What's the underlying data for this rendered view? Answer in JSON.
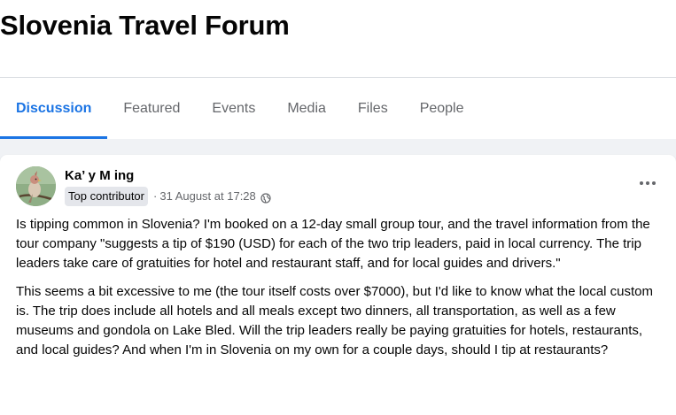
{
  "group": {
    "title": "Slovenia Travel Forum"
  },
  "tabs": [
    {
      "label": "Discussion",
      "active": true
    },
    {
      "label": "Featured",
      "active": false
    },
    {
      "label": "Events",
      "active": false
    },
    {
      "label": "Media",
      "active": false
    },
    {
      "label": "Files",
      "active": false
    },
    {
      "label": "People",
      "active": false
    }
  ],
  "post": {
    "author": "Ka’ y M  ing",
    "badge": "Top contributor",
    "timestamp": "31 August at 17:28",
    "separator": "·",
    "privacy_icon": "globe-icon",
    "more_icon": "more-options-icon",
    "paragraphs": [
      "Is tipping common in Slovenia? I'm booked on a 12-day small group tour, and the travel information from the tour company \"suggests a tip of $190 (USD) for each of the two trip leaders, paid in local currency. The trip leaders take care of gratuities for hotel and restaurant staff, and for local guides and drivers.\"",
      "This seems a bit excessive to me (the tour itself costs over $7000), but I'd like to know what the local custom is. The trip does include all hotels and all meals except two dinners, all transportation, as well as a few museums and gondola on Lake Bled. Will the trip leaders really be paying gratuities for hotels, restaurants, and local guides? And when I'm in Slovenia on my own for a couple days, should I tip at restaurants?"
    ]
  },
  "colors": {
    "accent": "#1b74e4",
    "muted_text": "#65676b",
    "feed_background": "#f0f2f5",
    "badge_background": "#e4e6eb"
  }
}
